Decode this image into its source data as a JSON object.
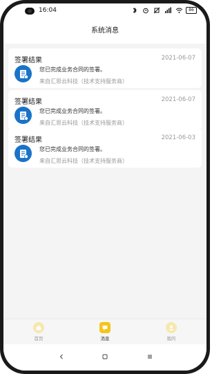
{
  "status_bar": {
    "time": "16:04",
    "battery": "86"
  },
  "header": {
    "title": "系统消息"
  },
  "messages": [
    {
      "title": "签署结果",
      "date": "2021-06-07",
      "text": "您已完成业务合同的签署。",
      "source": "来自汇思云科技（技术支持服务商）"
    },
    {
      "title": "签署结果",
      "date": "2021-06-07",
      "text": "您已完成业务合同的签署。",
      "source": "来自汇思云科技（技术支持服务商）"
    },
    {
      "title": "签署结果",
      "date": "2021-06-03",
      "text": "您已完成业务合同的签署。",
      "source": "来自汇思云科技（技术支持服务商）"
    }
  ],
  "bottom_nav": {
    "items": [
      {
        "label": "首页",
        "icon": "home-icon",
        "active": false
      },
      {
        "label": "消息",
        "icon": "message-icon",
        "active": true
      },
      {
        "label": "我的",
        "icon": "profile-icon",
        "active": false
      }
    ]
  },
  "colors": {
    "accent": "#f5c518",
    "icon_blue": "#1a73c8",
    "background": "#f4f4f4"
  }
}
